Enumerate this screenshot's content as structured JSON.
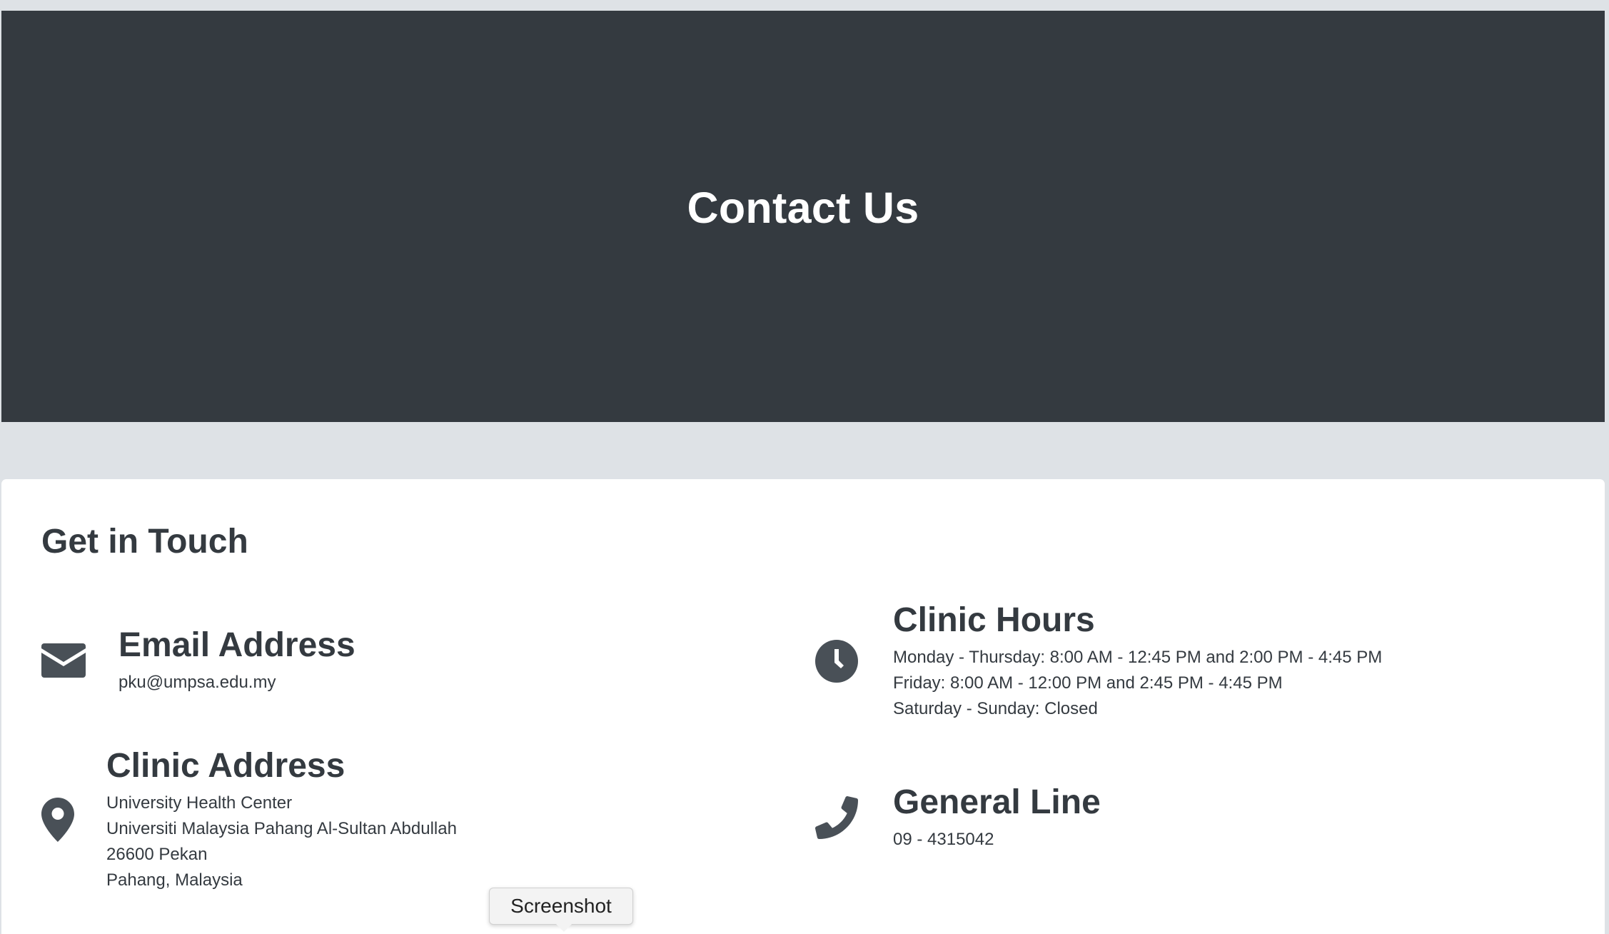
{
  "hero": {
    "title": "Contact Us"
  },
  "contact": {
    "title": "Get in Touch",
    "email": {
      "icon": "envelope-icon",
      "heading": "Email Address",
      "value": "pku@umpsa.edu.my"
    },
    "hours": {
      "icon": "clock-icon",
      "heading": "Clinic Hours",
      "lines": [
        "Monday - Thursday: 8:00 AM - 12:45 PM and 2:00 PM - 4:45 PM",
        "Friday: 8:00 AM - 12:00 PM and 2:45 PM - 4:45 PM",
        "Saturday - Sunday: Closed"
      ]
    },
    "address": {
      "icon": "map-marker-icon",
      "heading": "Clinic Address",
      "lines": [
        "University Health Center",
        "Universiti Malaysia Pahang Al-Sultan Abdullah",
        "26600 Pekan",
        "Pahang, Malaysia"
      ]
    },
    "phone": {
      "icon": "phone-icon",
      "heading": "General Line",
      "value": "09 - 4315042"
    }
  },
  "tooltip": {
    "label": "Screenshot"
  },
  "colors": {
    "page_background": "#dee2e6",
    "hero_background": "#343a40",
    "card_background": "#ffffff",
    "text": "#343a40",
    "icon": "#495057"
  }
}
